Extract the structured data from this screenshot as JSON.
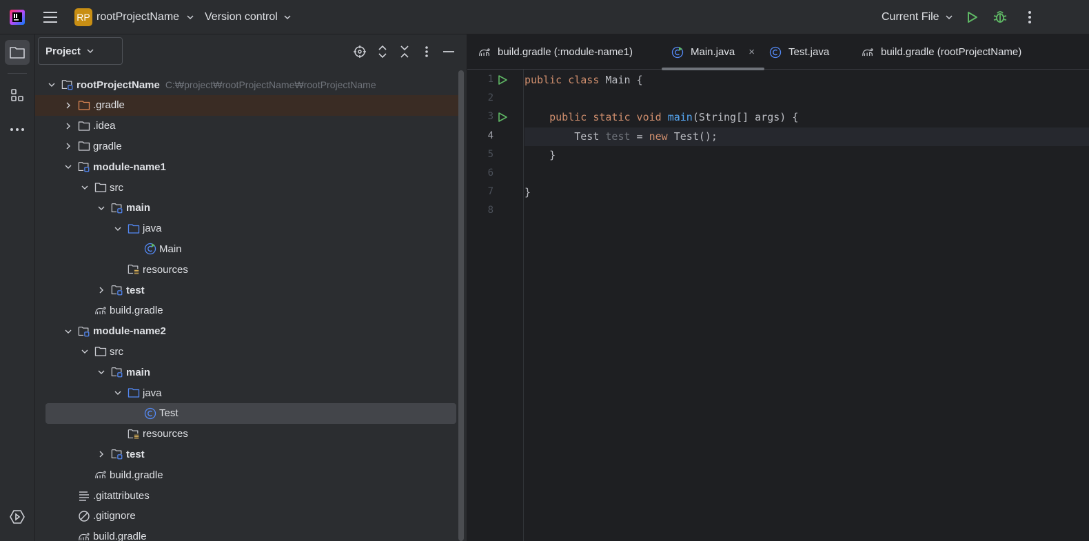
{
  "toolbar": {
    "logo_icon": "intellij-logo-icon",
    "menu_icon": "hamburger-icon",
    "project_badge": "RP",
    "project_name": "rootProjectName",
    "vcs_label": "Version control",
    "run_config": "Current File",
    "run_icon": "run-icon",
    "debug_icon": "debug-icon",
    "more_icon": "more-vertical-icon",
    "accent_green": "#5fb865",
    "badge_color": "#c98f14"
  },
  "left_stripe": {
    "items": [
      "project-folder-icon",
      "structure-icon",
      "more-horizontal-icon",
      "services-icon"
    ]
  },
  "project_panel": {
    "view_label": "Project",
    "header_icons": [
      "locate-icon",
      "expand-all-icon",
      "collapse-all-icon",
      "options-icon",
      "hide-icon"
    ],
    "tree": [
      {
        "label": "rootProjectName",
        "path": "C:₩project₩rootProjectName₩rootProjectName",
        "bold": true,
        "expanded": true,
        "icon": "module-folder-icon"
      },
      {
        "label": ".gradle",
        "expanded": false,
        "icon": "excluded-folder-icon",
        "highlighted": true
      },
      {
        "label": ".idea",
        "expanded": false,
        "icon": "folder-icon"
      },
      {
        "label": "gradle",
        "expanded": false,
        "icon": "folder-icon"
      },
      {
        "label": "module-name1",
        "bold": true,
        "expanded": true,
        "icon": "module-folder-icon"
      },
      {
        "label": "src",
        "expanded": true,
        "icon": "folder-icon"
      },
      {
        "label": "main",
        "bold": true,
        "expanded": true,
        "icon": "module-folder-icon"
      },
      {
        "label": "java",
        "expanded": true,
        "icon": "source-folder-icon"
      },
      {
        "label": "Main",
        "icon": "main-class-icon"
      },
      {
        "label": "resources",
        "icon": "resources-folder-icon"
      },
      {
        "label": "test",
        "bold": true,
        "expanded": false,
        "icon": "module-folder-icon"
      },
      {
        "label": "build.gradle",
        "icon": "gradle-elephant-icon"
      },
      {
        "label": "module-name2",
        "bold": true,
        "expanded": true,
        "icon": "module-folder-icon"
      },
      {
        "label": "src",
        "expanded": true,
        "icon": "folder-icon"
      },
      {
        "label": "main",
        "bold": true,
        "expanded": true,
        "icon": "module-folder-icon"
      },
      {
        "label": "java",
        "expanded": true,
        "icon": "source-folder-icon"
      },
      {
        "label": "Test",
        "icon": "class-icon",
        "selected": true
      },
      {
        "label": "resources",
        "icon": "resources-folder-icon"
      },
      {
        "label": "test",
        "bold": true,
        "expanded": false,
        "icon": "module-folder-icon"
      },
      {
        "label": "build.gradle",
        "icon": "gradle-elephant-icon"
      },
      {
        "label": ".gitattributes",
        "icon": "text-lines-icon"
      },
      {
        "label": ".gitignore",
        "icon": "ignore-icon"
      },
      {
        "label": "build.gradle",
        "icon": "gradle-elephant-icon"
      }
    ]
  },
  "editor": {
    "tabs": [
      {
        "label": "build.gradle (:module-name1)",
        "icon": "gradle-elephant-icon",
        "active": false
      },
      {
        "label": "Main.java",
        "icon": "main-class-icon",
        "active": true,
        "close": "×"
      },
      {
        "label": "Test.java",
        "icon": "class-icon",
        "active": false
      },
      {
        "label": "build.gradle (rootProjectName)",
        "icon": "gradle-elephant-icon",
        "active": false
      }
    ],
    "current_line": 4,
    "run_gutter_lines": [
      1,
      3
    ],
    "lines": [
      {
        "n": "1",
        "tokens": [
          [
            "kw",
            "public class "
          ],
          [
            "t",
            "Main {"
          ]
        ]
      },
      {
        "n": "2",
        "tokens": []
      },
      {
        "n": "3",
        "tokens": [
          [
            "t",
            "    "
          ],
          [
            "kw",
            "public static void "
          ],
          [
            "fn",
            "main"
          ],
          [
            "t",
            "(String[] args) {"
          ]
        ]
      },
      {
        "n": "4",
        "tokens": [
          [
            "t",
            "        Test "
          ],
          [
            "unused",
            "test"
          ],
          [
            "t",
            " = "
          ],
          [
            "kw",
            "new "
          ],
          [
            "t",
            "Test();"
          ]
        ]
      },
      {
        "n": "5",
        "tokens": [
          [
            "t",
            "    }"
          ]
        ]
      },
      {
        "n": "6",
        "tokens": []
      },
      {
        "n": "7",
        "tokens": [
          [
            "t",
            "}"
          ]
        ]
      },
      {
        "n": "8",
        "tokens": []
      }
    ]
  }
}
